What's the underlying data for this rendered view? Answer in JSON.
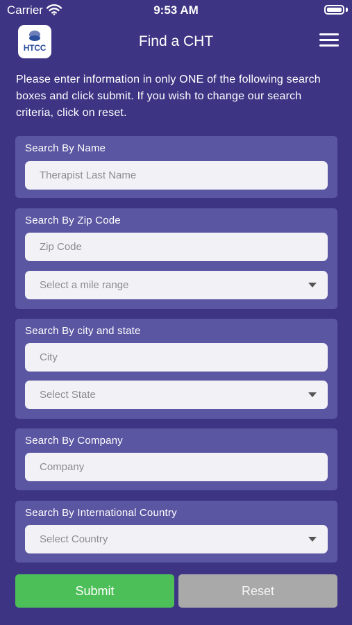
{
  "status_bar": {
    "carrier": "Carrier",
    "time": "9:53 AM"
  },
  "nav": {
    "logo_text": "HTCC",
    "title": "Find a CHT"
  },
  "instructions": "Please enter information in only ONE of the following search boxes and click submit. If you wish to change our search criteria, click on reset.",
  "sections": {
    "name": {
      "label": "Search By Name",
      "placeholder": "Therapist Last Name"
    },
    "zip": {
      "label": "Search By Zip Code",
      "placeholder": "Zip Code",
      "select": "Select a mile range"
    },
    "city_state": {
      "label": "Search By city and state",
      "placeholder": "City",
      "select": "Select State"
    },
    "company": {
      "label": "Search By Company",
      "placeholder": "Company"
    },
    "country": {
      "label": "Search By International Country",
      "select": "Select Country"
    }
  },
  "buttons": {
    "submit": "Submit",
    "reset": "Reset"
  },
  "colors": {
    "background": "#3d3584",
    "card": "#5b56a2",
    "submit": "#4cbf58",
    "reset": "#a9a9a9"
  }
}
